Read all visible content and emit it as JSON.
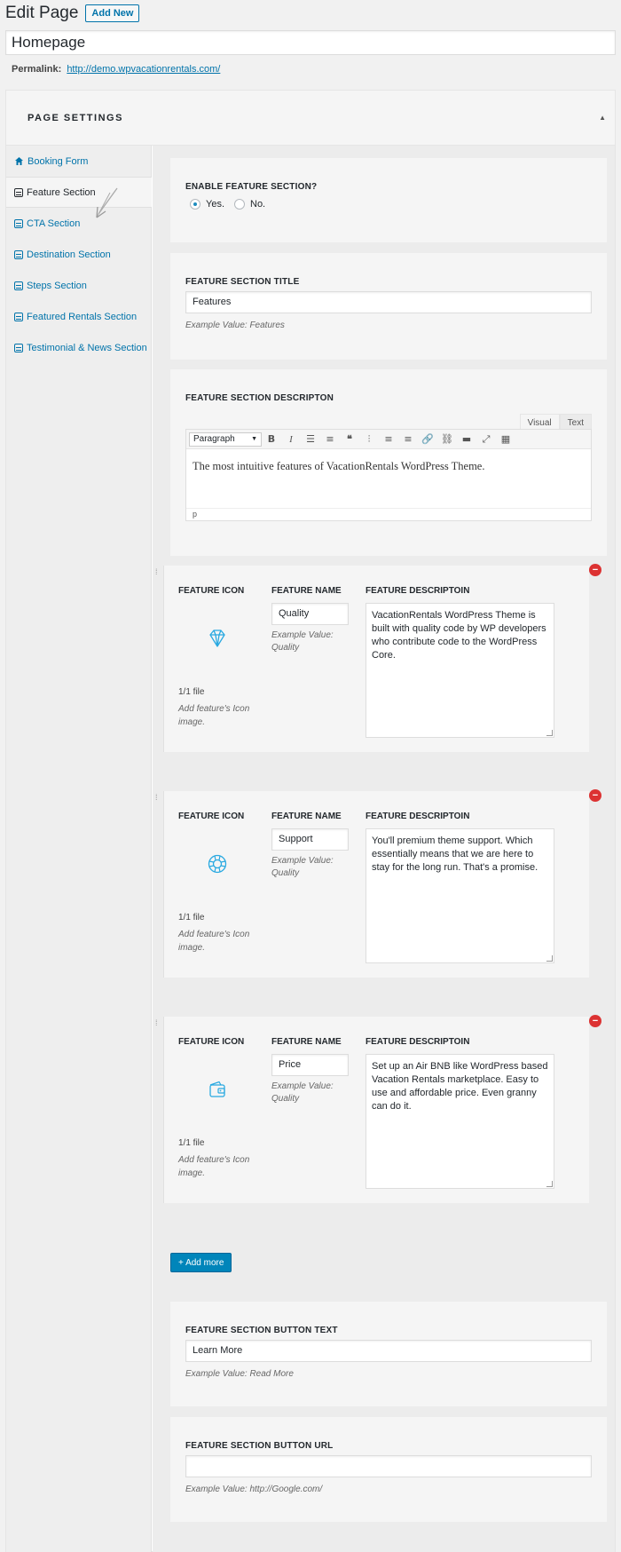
{
  "header": {
    "title": "Edit Page",
    "add_new": "Add New"
  },
  "post": {
    "title": "Homepage"
  },
  "permalink": {
    "label": "Permalink:",
    "url": "http://demo.wpvacationrentals.com/"
  },
  "settings": {
    "heading": "PAGE SETTINGS"
  },
  "sidebar": {
    "items": [
      {
        "label": "Booking Form"
      },
      {
        "label": "Feature Section"
      },
      {
        "label": "CTA Section"
      },
      {
        "label": "Destination Section"
      },
      {
        "label": "Steps Section"
      },
      {
        "label": "Featured Rentals Section"
      },
      {
        "label": "Testimonial & News Section"
      }
    ]
  },
  "enable": {
    "label": "ENABLE FEATURE SECTION?",
    "yes": "Yes.",
    "no": "No.",
    "selected": "yes"
  },
  "title_field": {
    "label": "FEATURE SECTION TITLE",
    "value": "Features",
    "example": "Example Value: Features"
  },
  "desc_field": {
    "label": "FEATURE SECTION DESCRIPTON",
    "tab_visual": "Visual",
    "tab_text": "Text",
    "format": "Paragraph",
    "content": "The most intuitive features of VacationRentals WordPress Theme.",
    "path": "p"
  },
  "features": [
    {
      "icon_label": "FEATURE ICON",
      "name_label": "FEATURE NAME",
      "desc_label": "FEATURE DESCRIPTOIN",
      "icon": "diamond-icon",
      "name": "Quality",
      "name_example": "Example Value: Quality",
      "file_count": "1/1 file",
      "file_hint": "Add feature's Icon image.",
      "description": "VacationRentals WordPress Theme is built with quality code by WP developers who contribute code to the WordPress Core."
    },
    {
      "icon_label": "FEATURE ICON",
      "name_label": "FEATURE NAME",
      "desc_label": "FEATURE DESCRIPTOIN",
      "icon": "lifebuoy-icon",
      "name": "Support",
      "name_example": "Example Value: Quality",
      "file_count": "1/1 file",
      "file_hint": "Add feature's Icon image.",
      "description": "You'll premium theme support. Which essentially means that we are here to stay for the long run. That's a promise."
    },
    {
      "icon_label": "FEATURE ICON",
      "name_label": "FEATURE NAME",
      "desc_label": "FEATURE DESCRIPTOIN",
      "icon": "wallet-icon",
      "name": "Price",
      "name_example": "Example Value: Quality",
      "file_count": "1/1 file",
      "file_hint": "Add feature's Icon image.",
      "description": "Set up an Air BNB like WordPress based Vacation Rentals marketplace. Easy to use and affordable price. Even granny can do it."
    }
  ],
  "add_more": "+ Add more",
  "button_text": {
    "label": "FEATURE SECTION BUTTON TEXT",
    "value": "Learn More",
    "example": "Example Value: Read More"
  },
  "button_url": {
    "label": "FEATURE SECTION BUTTON URL",
    "value": "",
    "example": "Example Value: http://Google.com/"
  },
  "colors": {
    "accent": "#0073aa",
    "icon_blue": "#29a9e1",
    "remove_red": "#dc3232"
  }
}
